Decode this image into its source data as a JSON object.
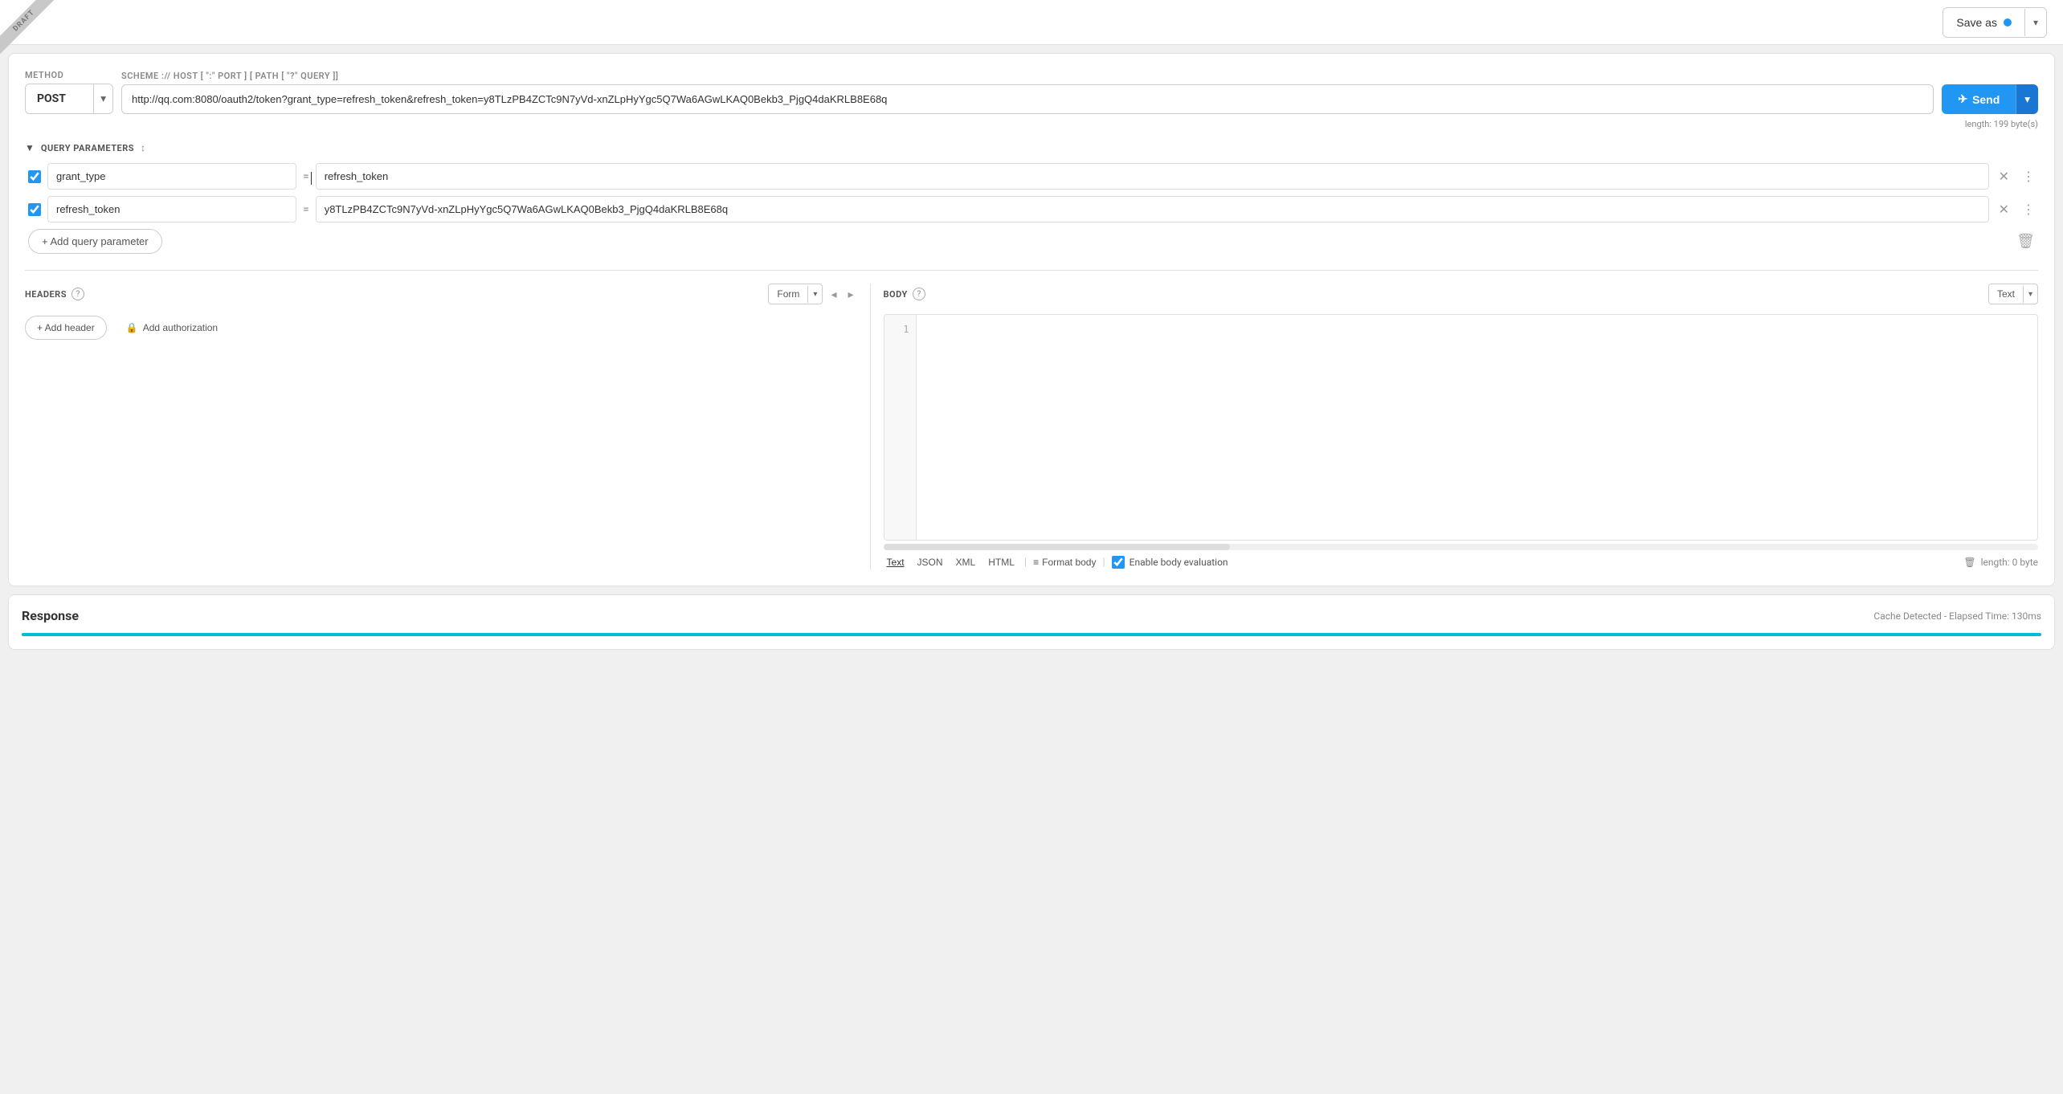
{
  "topbar": {
    "save_as_label": "Save as",
    "save_as_chevron": "▾"
  },
  "request": {
    "method_label": "METHOD",
    "method_value": "POST",
    "scheme_label": "SCHEME :// HOST [ \":\" PORT ] [ PATH [ \"?\" QUERY ]]",
    "url_value": "http://qq.com:8080/oauth2/token?grant_type=refresh_token&refresh_token=y8TLzPB4ZCTc9N7yVd-xnZLpHyYgc5Q7Wa6AGwLKAQ0Bekb3_PjgQ4daKRLB8E68q",
    "url_length": "length: 199 byte(s)",
    "send_label": "Send"
  },
  "query_params": {
    "section_title": "QUERY PARAMETERS",
    "rows": [
      {
        "enabled": true,
        "key": "grant_type",
        "value": "refresh_token"
      },
      {
        "enabled": true,
        "key": "refresh_token",
        "value": "y8TLzPB4ZCTc9N7yVd-xnZLpHyYgc5Q7Wa6AGwLKAQ0Bekb3_PjgQ4daKRLB8E68q"
      }
    ],
    "add_param_label": "+ Add query parameter"
  },
  "headers": {
    "title": "HEADERS",
    "form_label": "Form",
    "add_header_label": "+ Add header",
    "add_auth_label": "Add authorization",
    "nav_prev": "◂",
    "nav_next": "▸"
  },
  "body": {
    "title": "BODY",
    "text_label": "Text",
    "format_body_label": "Format body",
    "enable_eval_label": "Enable body evaluation",
    "length_label": "length: 0 byte",
    "format_tabs": [
      "Text",
      "JSON",
      "XML",
      "HTML"
    ],
    "active_tab": "Text",
    "line_number": "1"
  },
  "response": {
    "title": "Response",
    "cache_info": "Cache Detected - Elapsed Time: 130ms"
  },
  "draft_label": "DRAFT"
}
